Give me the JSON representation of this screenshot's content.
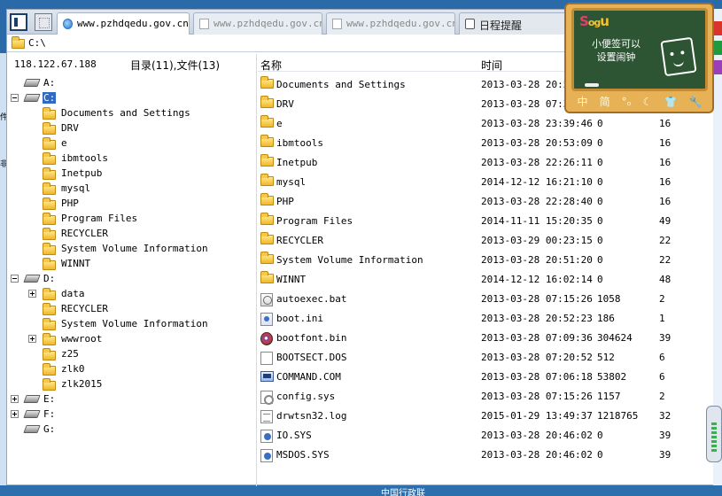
{
  "tabs": [
    {
      "label": "www.pzhdqedu.gov.cn",
      "active": true,
      "icon": "globe-icon"
    },
    {
      "label": "www.pzhdqedu.gov.cn",
      "active": false,
      "icon": "page-icon"
    },
    {
      "label": "www.pzhdqedu.gov.cn",
      "active": false,
      "icon": "page-icon"
    },
    {
      "label": "日程提醒",
      "active": false,
      "icon": "clock-icon"
    }
  ],
  "address": {
    "path": "C:\\"
  },
  "left_header": {
    "ip": "118.122.67.188",
    "summary": "目录(11),文件(13)"
  },
  "tree": {
    "drives": {
      "a": "A:",
      "c": "C:",
      "d": "D:",
      "e": "E:",
      "f": "F:",
      "g": "G:"
    },
    "c_items": [
      "Documents and Settings",
      "DRV",
      "e",
      "ibmtools",
      "Inetpub",
      "mysql",
      "PHP",
      "Program Files",
      "RECYCLER",
      "System Volume Information",
      "WINNT"
    ],
    "d_items": [
      "data",
      "RECYCLER",
      "System Volume Information",
      "wwwroot",
      "z25",
      "zlk0",
      "zlk2015"
    ]
  },
  "list_header": {
    "name": "名称",
    "time": "时间"
  },
  "files": [
    {
      "name": "Documents and Settings",
      "time": "2013-03-28 20:51",
      "size": "",
      "attr": "",
      "type": "folder"
    },
    {
      "name": "DRV",
      "time": "2013-03-28 07:31",
      "size": "",
      "attr": "",
      "type": "folder"
    },
    {
      "name": "e",
      "time": "2013-03-28 23:39:46",
      "size": "0",
      "attr": "16",
      "type": "folder"
    },
    {
      "name": "ibmtools",
      "time": "2013-03-28 20:53:09",
      "size": "0",
      "attr": "16",
      "type": "folder"
    },
    {
      "name": "Inetpub",
      "time": "2013-03-28 22:26:11",
      "size": "0",
      "attr": "16",
      "type": "folder"
    },
    {
      "name": "mysql",
      "time": "2014-12-12 16:21:10",
      "size": "0",
      "attr": "16",
      "type": "folder"
    },
    {
      "name": "PHP",
      "time": "2013-03-28 22:28:40",
      "size": "0",
      "attr": "16",
      "type": "folder"
    },
    {
      "name": "Program Files",
      "time": "2014-11-11 15:20:35",
      "size": "0",
      "attr": "49",
      "type": "folder"
    },
    {
      "name": "RECYCLER",
      "time": "2013-03-29 00:23:15",
      "size": "0",
      "attr": "22",
      "type": "folder"
    },
    {
      "name": "System Volume Information",
      "time": "2013-03-28 20:51:20",
      "size": "0",
      "attr": "22",
      "type": "folder"
    },
    {
      "name": "WINNT",
      "time": "2014-12-12 16:02:14",
      "size": "0",
      "attr": "48",
      "type": "folder"
    },
    {
      "name": "autoexec.bat",
      "time": "2013-03-28 07:15:26",
      "size": "1058",
      "attr": "2",
      "type": "bat"
    },
    {
      "name": "boot.ini",
      "time": "2013-03-28 20:52:23",
      "size": "186",
      "attr": "1",
      "type": "ini"
    },
    {
      "name": "bootfont.bin",
      "time": "2013-03-28 07:09:36",
      "size": "304624",
      "attr": "39",
      "type": "bin"
    },
    {
      "name": "BOOTSECT.DOS",
      "time": "2013-03-28 07:20:52",
      "size": "512",
      "attr": "6",
      "type": "dos"
    },
    {
      "name": "COMMAND.COM",
      "time": "2013-03-28 07:06:18",
      "size": "53802",
      "attr": "6",
      "type": "com"
    },
    {
      "name": "config.sys",
      "time": "2013-03-28 07:15:26",
      "size": "1157",
      "attr": "2",
      "type": "sys"
    },
    {
      "name": "drwtsn32.log",
      "time": "2015-01-29 13:49:37",
      "size": "1218765",
      "attr": "32",
      "type": "log"
    },
    {
      "name": "IO.SYS",
      "time": "2013-03-28 20:46:02",
      "size": "0",
      "attr": "39",
      "type": "iosys"
    },
    {
      "name": "MSDOS.SYS",
      "time": "2013-03-28 20:46:02",
      "size": "0",
      "attr": "39",
      "type": "iosys"
    }
  ],
  "note_widget": {
    "logo_s": "S",
    "logo_rest": "og",
    "logo_u": "u",
    "line1": "小便签可以",
    "line2": "设置闹钟",
    "bar_items": [
      "中",
      "简",
      "°ₒ",
      "☾",
      "👕",
      "🔧"
    ]
  },
  "desktop": {
    "taskbar_text": "中国行政联"
  },
  "colors": {
    "selection": "#316ac5",
    "board": "#2d5433",
    "note_frame": "#e7b255"
  }
}
